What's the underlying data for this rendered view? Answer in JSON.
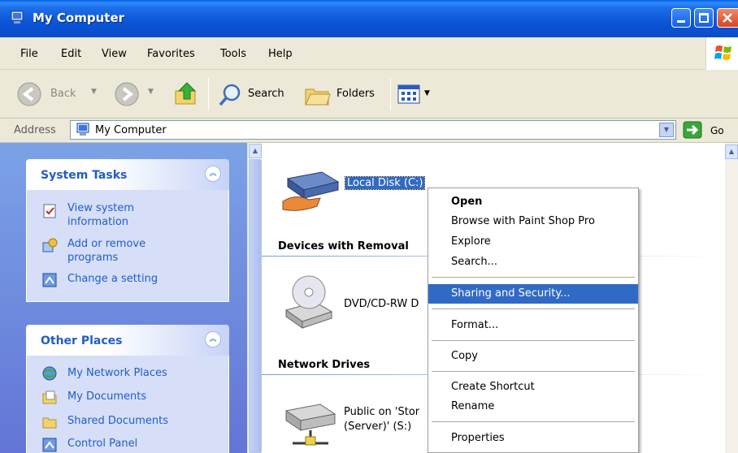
{
  "window": {
    "title": "My Computer"
  },
  "menubar": {
    "items": [
      "File",
      "Edit",
      "View",
      "Favorites",
      "Tools",
      "Help"
    ]
  },
  "toolbar": {
    "back": "Back",
    "search": "Search",
    "folders": "Folders"
  },
  "address": {
    "label": "Address",
    "value": "My Computer",
    "go": "Go"
  },
  "taskpane": {
    "system_tasks": {
      "title": "System Tasks",
      "items": [
        "View system information",
        "Add or remove programs",
        "Change a setting"
      ]
    },
    "other_places": {
      "title": "Other Places",
      "items": [
        "My Network Places",
        "My Documents",
        "Shared Documents",
        "Control Panel"
      ]
    }
  },
  "content": {
    "local_disk": "Local Disk (C:)",
    "group_removable": "Devices with Removal",
    "dvd_drive": "DVD/CD-RW D",
    "group_network": "Network Drives",
    "network_drive_line1": "Public on 'Stor",
    "network_drive_line2": "(Server)' (S:)"
  },
  "context_menu": {
    "items": [
      "Open",
      "Browse with Paint Shop Pro",
      "Explore",
      "Search...",
      "Sharing and Security...",
      "Format...",
      "Copy",
      "Create Shortcut",
      "Rename",
      "Properties"
    ],
    "highlighted": "Sharing and Security..."
  },
  "colors": {
    "titlebar": "#0a55d8",
    "highlight": "#316ac5",
    "link": "#215dc6",
    "taskpane": "#7ba2e7"
  }
}
